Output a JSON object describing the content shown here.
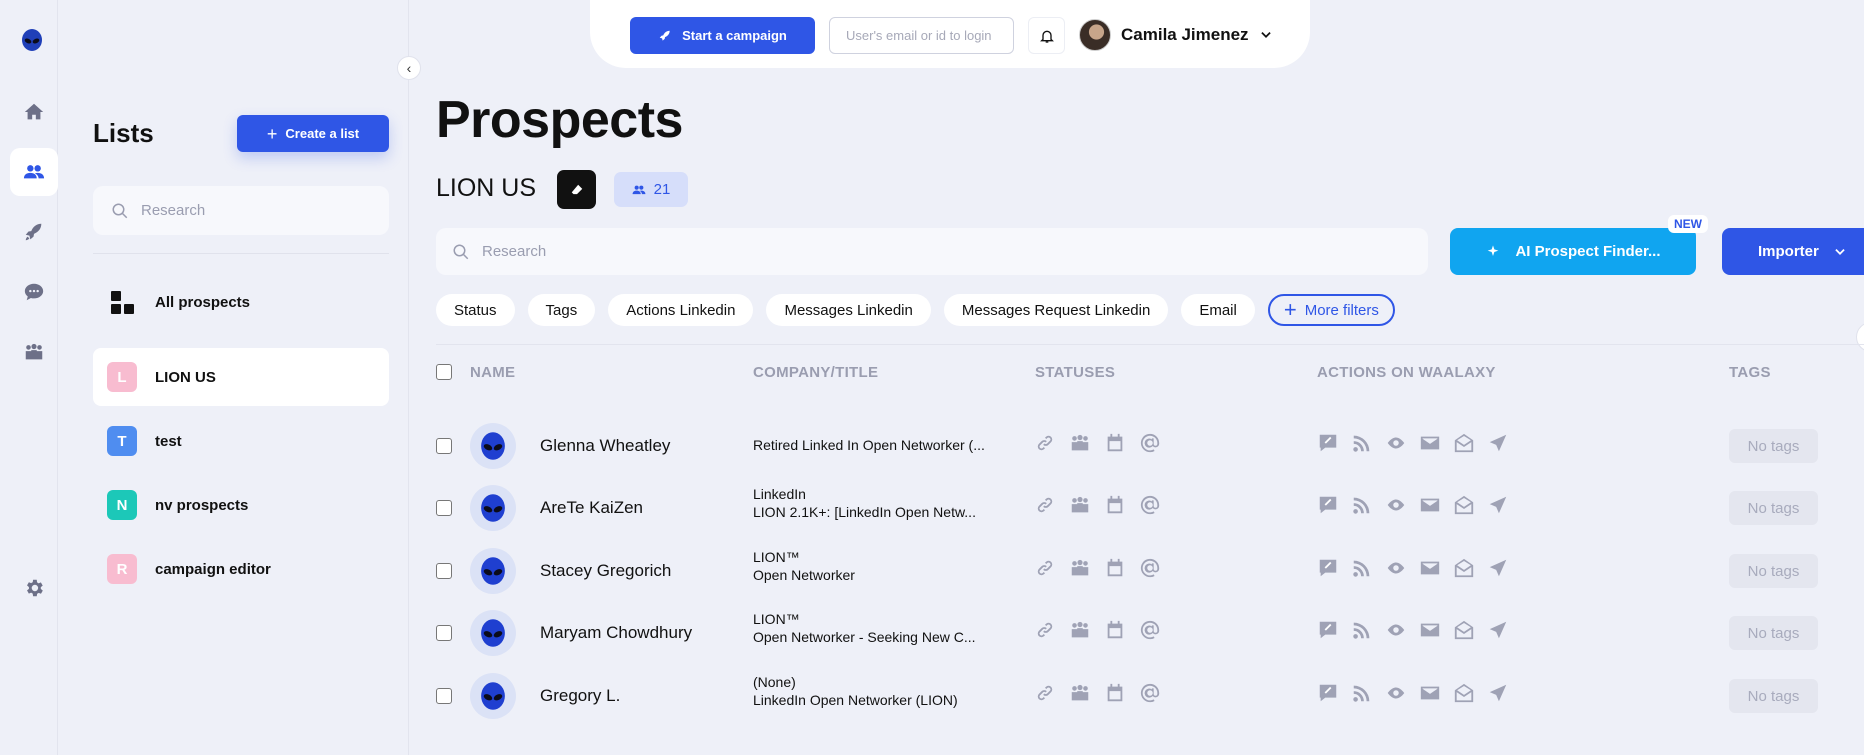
{
  "rail": {
    "items": [
      {
        "name": "home-icon"
      },
      {
        "name": "prospects-icon",
        "active": true
      },
      {
        "name": "rocket-icon"
      },
      {
        "name": "messages-icon"
      },
      {
        "name": "team-icon"
      },
      {
        "name": "settings-icon"
      }
    ]
  },
  "lists_panel": {
    "title": "Lists",
    "create_label": "Create a list",
    "search_placeholder": "Research",
    "all_prospects_label": "All prospects",
    "items": [
      {
        "initial": "L",
        "label": "LION US",
        "color": "#f8bcd0",
        "active": true
      },
      {
        "initial": "T",
        "label": "test",
        "color": "#4f8df0"
      },
      {
        "initial": "N",
        "label": "nv prospects",
        "color": "#1cc8b8"
      },
      {
        "initial": "R",
        "label": "campaign editor",
        "color": "#f8bcd0"
      }
    ]
  },
  "topbar": {
    "campaign_label": "Start a campaign",
    "login_placeholder": "User's email or id to login",
    "user_name": "Camila Jimenez"
  },
  "main": {
    "title": "Prospects",
    "list_name": "LION US",
    "prospect_count": "21",
    "search_placeholder": "Research",
    "ai_label": "AI Prospect Finder...",
    "new_badge": "NEW",
    "importer_label": "Importer",
    "filters": [
      "Status",
      "Tags",
      "Actions Linkedin",
      "Messages Linkedin",
      "Messages Request Linkedin",
      "Email"
    ],
    "more_filters_label": "More filters"
  },
  "table": {
    "headers": {
      "name": "NAME",
      "company": "COMPANY/TITLE",
      "statuses": "STATUSES",
      "actions": "ACTIONS ON WAALAXY",
      "tags": "TAGS"
    },
    "rows": [
      {
        "name": "Glenna Wheatley",
        "line1": "Retired Linked In Open Networker (...",
        "line2": "",
        "tags": "No tags"
      },
      {
        "name": "AreTe KaiZen",
        "line1": "LinkedIn",
        "line2": "LION 2.1K+: [LinkedIn Open Netw...",
        "tags": "No tags"
      },
      {
        "name": "Stacey Gregorich",
        "line1": "LION™",
        "line2": "Open Networker",
        "tags": "No tags"
      },
      {
        "name": "Maryam Chowdhury",
        "line1": "LION™",
        "line2": "Open Networker - Seeking New C...",
        "tags": "No tags"
      },
      {
        "name": "Gregory L.",
        "line1": "(None)",
        "line2": "LinkedIn Open Networker (LION)",
        "tags": "No tags"
      }
    ]
  },
  "colors": {
    "primary": "#2f56e6",
    "ai_button": "#10a5f0",
    "background": "#eef0f8",
    "icon_gray": "#9fa2b5"
  }
}
